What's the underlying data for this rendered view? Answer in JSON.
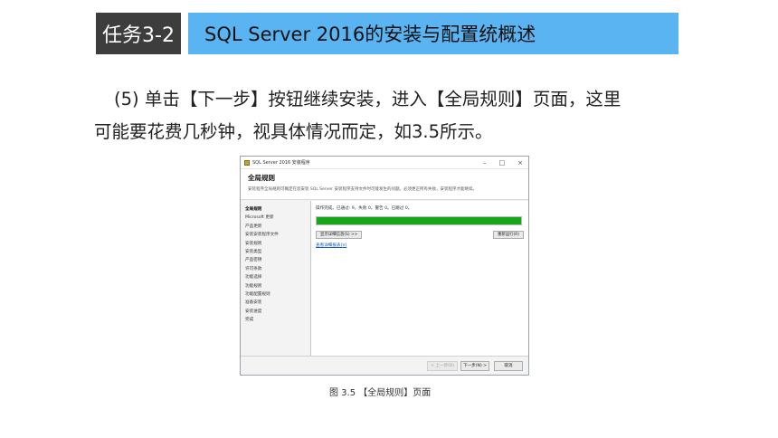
{
  "header": {
    "task_label": "任务3-2",
    "title": "SQL Server 2016的安装与配置统概述"
  },
  "paragraph": {
    "line1": "(5) 单击【下一步】按钮继续安装，进入【全局规则】页面，这里",
    "line2": "可能要花费几秒钟，视具体情况而定，如3.5所示。"
  },
  "dialog": {
    "window_title": "SQL Server 2016 安装程序",
    "controls": {
      "minimize": "–",
      "maximize": "□",
      "close": "×"
    },
    "page_title": "全局规则",
    "page_desc": "安装程序全局规则可确定在您安装 SQL Server 安装程序支持文件时可能发生的问题。必须更正所有失败，安装程序才能继续。",
    "sidebar": [
      "全局规则",
      "Microsoft 更新",
      "产品更新",
      "安装安装程序文件",
      "安装规则",
      "安装类型",
      "产品密钥",
      "许可条款",
      "功能选择",
      "功能规则",
      "功能配置规则",
      "准备安装",
      "安装进度",
      "完成"
    ],
    "status": "操作完成。已通过: 9。失败 0。警告 0。已跳过 0。",
    "progress": 1.0,
    "show_details_label": "显示详细信息(S) >>",
    "rerun_label": "重新运行(R)",
    "report_link": "查看详细报表(V)",
    "buttons": {
      "prev": "< 上一步(B)",
      "next": "下一步(N) >",
      "cancel": "取消"
    }
  },
  "caption": "图 3.5 【全局规则】页面",
  "colors": {
    "badge_bg": "#3d3d3d",
    "title_bg": "#5bb4f2",
    "progress_fill": "#19a519",
    "link": "#1a5fb4"
  }
}
